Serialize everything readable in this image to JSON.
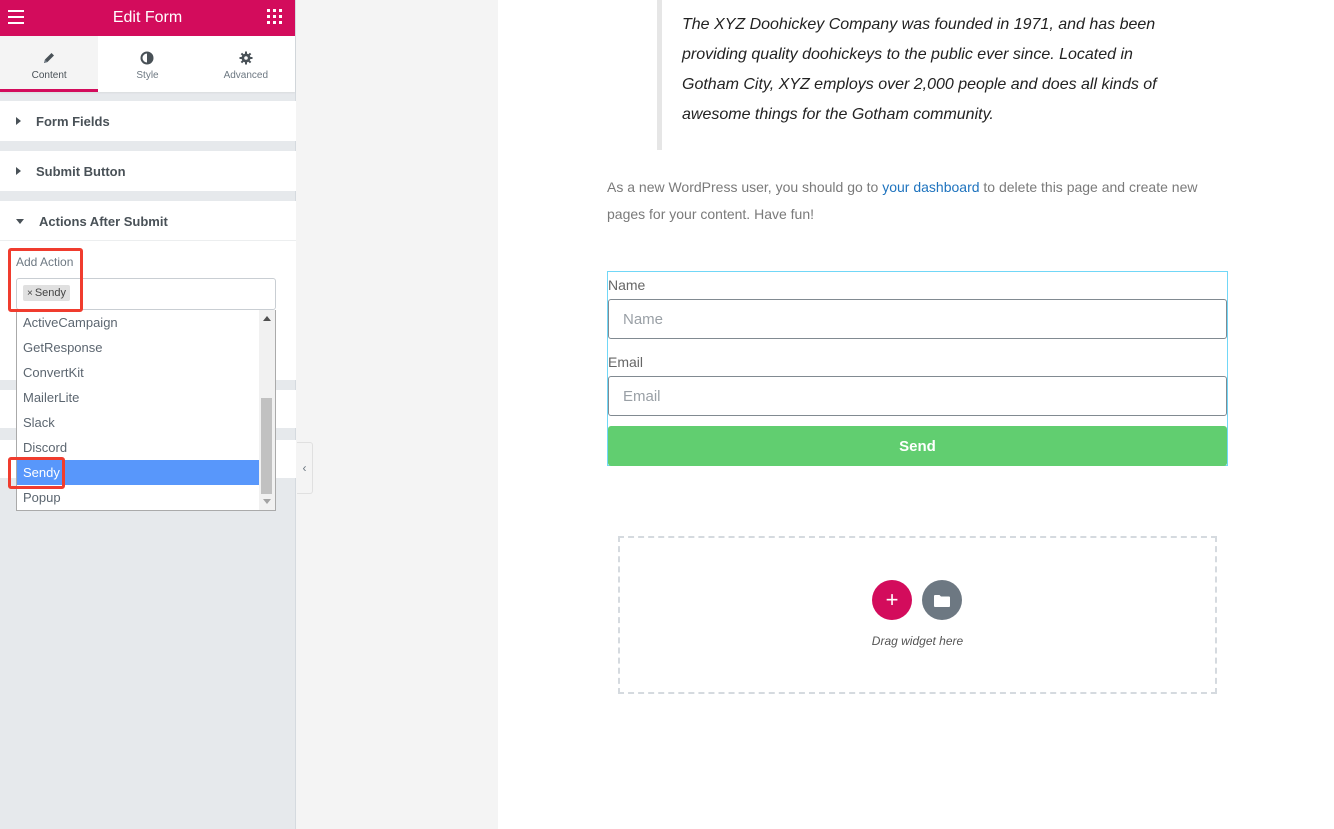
{
  "panel": {
    "title": "Edit Form",
    "tabs": [
      {
        "label": "Content",
        "icon": "pencil-icon"
      },
      {
        "label": "Style",
        "icon": "half-circle-icon"
      },
      {
        "label": "Advanced",
        "icon": "gear-icon"
      }
    ],
    "sections": {
      "form_fields": "Form Fields",
      "submit_button": "Submit Button",
      "actions_after_submit": "Actions After Submit"
    },
    "add_action": {
      "label": "Add Action",
      "selected_tag": "Sendy",
      "tag_remove": "×",
      "options": [
        "ActiveCampaign",
        "GetResponse",
        "ConvertKit",
        "MailerLite",
        "Slack",
        "Discord",
        "Sendy",
        "Popup"
      ],
      "highlighted_option": "Sendy"
    },
    "collapse_icon": "‹",
    "accent_color": "#d30c5c",
    "highlight_color": "#f03c2e"
  },
  "page": {
    "quote": "The XYZ Doohickey Company was founded in 1971, and has been providing quality doohickeys to the public ever since. Located in Gotham City, XYZ employs over 2,000 people and does all kinds of awesome things for the Gotham community.",
    "paragraph": {
      "before": "As a new WordPress user, you should go to ",
      "link": "your dashboard",
      "after": " to delete this page and create new pages for your content. Have fun!"
    },
    "form": {
      "name_label": "Name",
      "name_placeholder": "Name",
      "email_label": "Email",
      "email_placeholder": "Email",
      "submit_label": "Send",
      "button_color": "#61ce70"
    },
    "dropzone": {
      "add_icon": "+",
      "text": "Drag widget here"
    }
  }
}
